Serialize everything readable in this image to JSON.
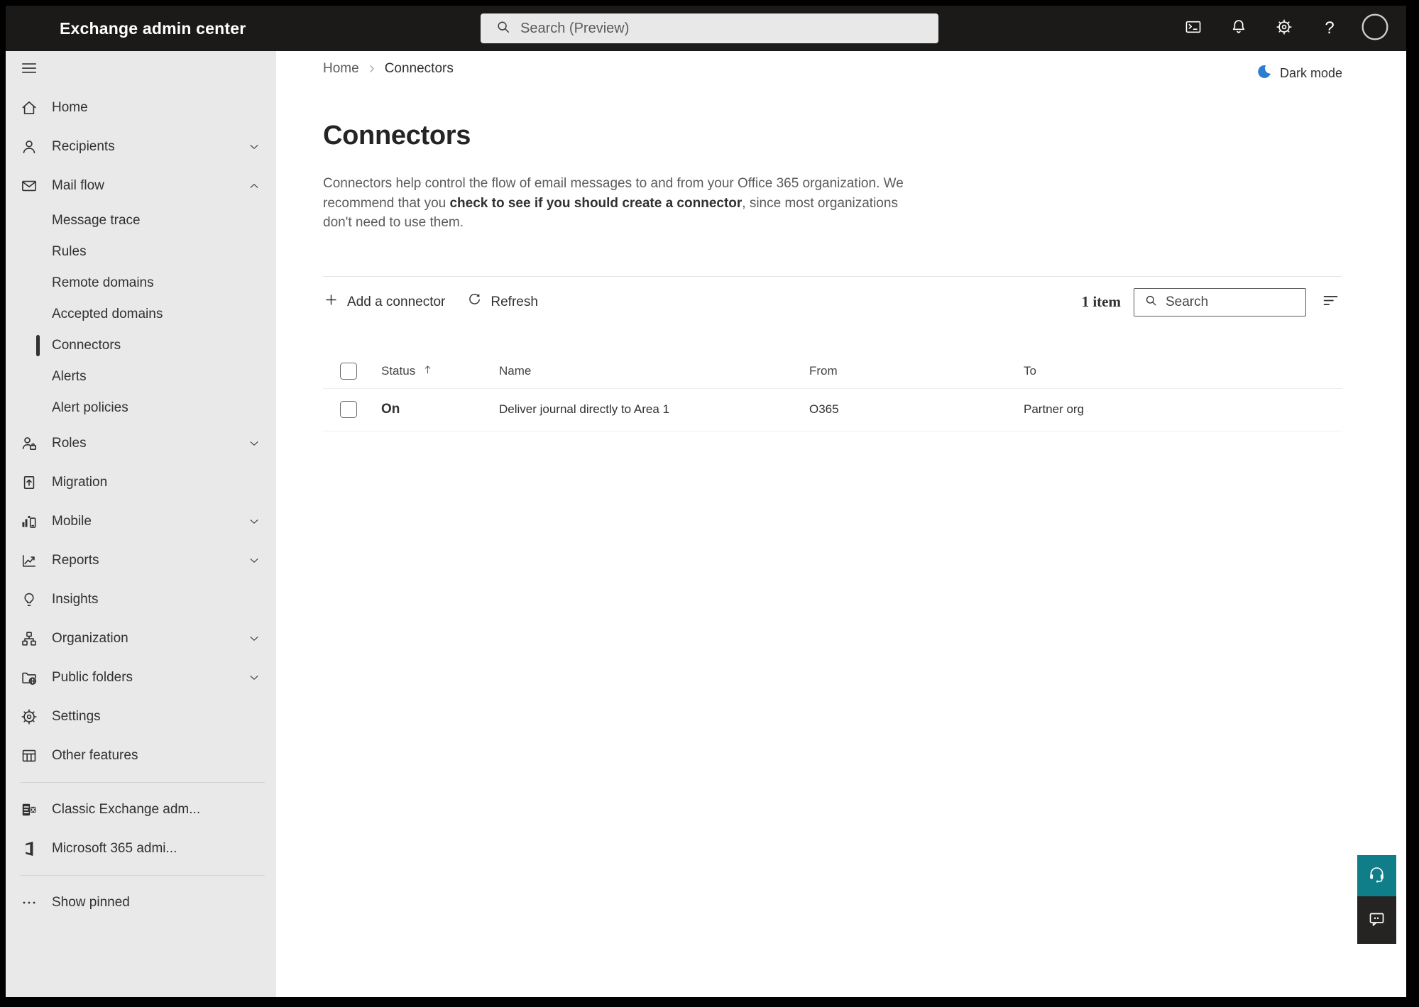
{
  "topbar": {
    "title": "Exchange admin center",
    "search_placeholder": "Search (Preview)",
    "icons_right": [
      "cloud-shell",
      "notifications",
      "settings",
      "help",
      "avatar"
    ]
  },
  "sidebar": {
    "items": [
      {
        "label": "Home",
        "icon": "home"
      },
      {
        "label": "Recipients",
        "icon": "person",
        "chevron": "down"
      },
      {
        "label": "Mail flow",
        "icon": "mail",
        "chevron": "up"
      },
      {
        "label": "Message trace",
        "sub": true
      },
      {
        "label": "Rules",
        "sub": true
      },
      {
        "label": "Remote domains",
        "sub": true
      },
      {
        "label": "Accepted domains",
        "sub": true
      },
      {
        "label": "Connectors",
        "sub": true,
        "selected": true
      },
      {
        "label": "Alerts",
        "sub": true
      },
      {
        "label": "Alert policies",
        "sub": true
      },
      {
        "label": "Roles",
        "icon": "roles",
        "chevron": "down"
      },
      {
        "label": "Migration",
        "icon": "migration"
      },
      {
        "label": "Mobile",
        "icon": "mobile",
        "chevron": "down"
      },
      {
        "label": "Reports",
        "icon": "reports",
        "chevron": "down"
      },
      {
        "label": "Insights",
        "icon": "insights"
      },
      {
        "label": "Organization",
        "icon": "organization",
        "chevron": "down"
      },
      {
        "label": "Public folders",
        "icon": "public-folders",
        "chevron": "down"
      },
      {
        "label": "Settings",
        "icon": "settings"
      },
      {
        "label": "Other features",
        "icon": "other-features"
      },
      {
        "divider": true
      },
      {
        "label": "Classic Exchange adm...",
        "icon": "classic-exchange"
      },
      {
        "label": "Microsoft 365 admi...",
        "icon": "m365"
      },
      {
        "divider": true
      },
      {
        "label": "Show pinned",
        "icon": "ellipsis"
      }
    ]
  },
  "breadcrumb": {
    "home": "Home",
    "current": "Connectors"
  },
  "dark_mode": {
    "label": "Dark mode",
    "icon_color": "#2b7cd3"
  },
  "page": {
    "title": "Connectors",
    "description_prefix": "Connectors help control the flow of email messages to and from your Office 365 organization. We recommend that you ",
    "description_emphasis": "check to see if you should create a connector",
    "description_suffix": ", since most organizations don't need to use them."
  },
  "toolbar": {
    "add_label": "Add a connector",
    "refresh_label": "Refresh",
    "item_count": "1 item",
    "search_placeholder": "Search"
  },
  "table": {
    "headers": {
      "status": "Status",
      "name": "Name",
      "from": "From",
      "to": "To"
    },
    "rows": [
      {
        "status": "On",
        "name": "Deliver journal directly to Area 1",
        "from": "O365",
        "to": "Partner org"
      }
    ]
  },
  "floating_buttons": [
    {
      "icon": "headset",
      "color": "#0f7e89"
    },
    {
      "icon": "chat",
      "color": "#252423"
    }
  ]
}
